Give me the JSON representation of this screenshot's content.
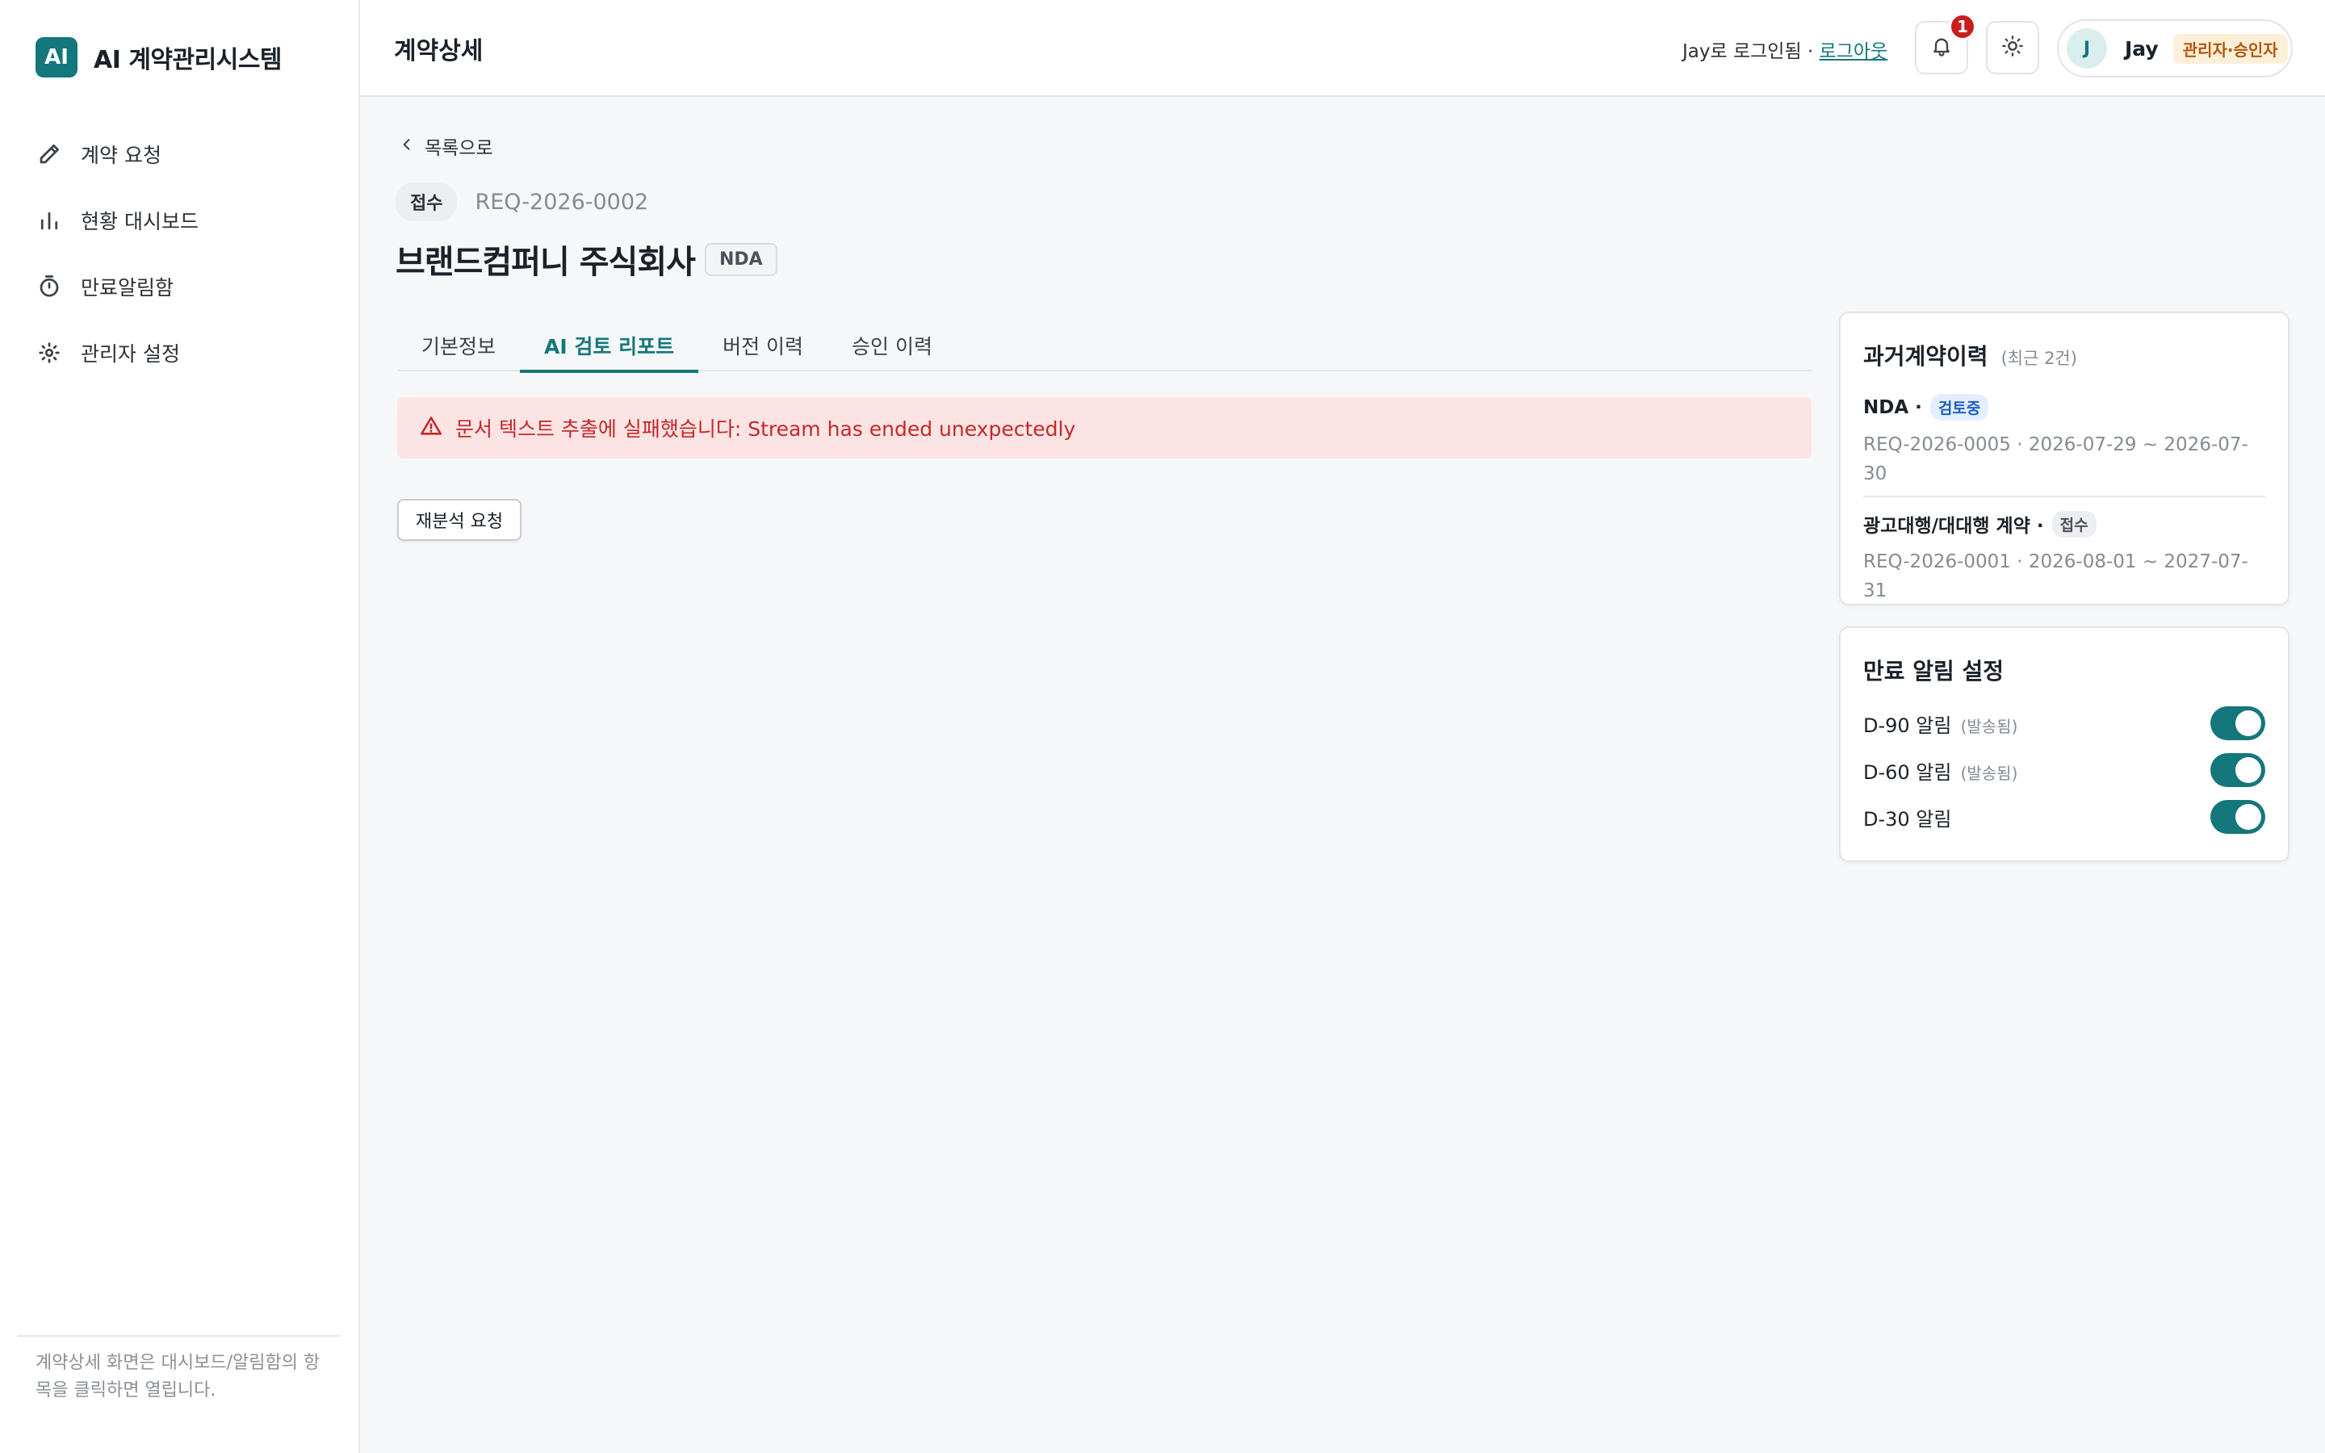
{
  "sidebar": {
    "logo_text": "AI",
    "title": "AI 계약관리시스템",
    "items": [
      {
        "label": "계약 요청",
        "icon": "pencil-icon"
      },
      {
        "label": "현황 대시보드",
        "icon": "bar-chart-icon"
      },
      {
        "label": "만료알림함",
        "icon": "timer-icon"
      },
      {
        "label": "관리자 설정",
        "icon": "gear-icon"
      }
    ],
    "footer_note": "계약상세 화면은 대시보드/알림함의 항목을 클릭하면 열립니다."
  },
  "header": {
    "title": "계약상세",
    "login_text": "Jay로 로그인됨 · ",
    "logout_label": "로그아웃",
    "notification_count": "1",
    "user_initial": "J",
    "user_name": "Jay",
    "user_role": "관리자·승인자"
  },
  "main": {
    "back_label": "목록으로",
    "status": "접수",
    "request_id": "REQ-2026-0002",
    "contract_title": "브랜드컴퍼니 주식회사",
    "contract_type": "NDA",
    "tabs": [
      {
        "label": "기본정보",
        "active": false
      },
      {
        "label": "AI 검토 리포트",
        "active": true
      },
      {
        "label": "버전 이력",
        "active": false
      },
      {
        "label": "승인 이력",
        "active": false
      }
    ],
    "error_message": "문서 텍스트 추출에 실패했습니다: Stream has ended unexpectedly",
    "reanalyze_label": "재분석 요청"
  },
  "history_card": {
    "title": "과거계약이력",
    "subtitle": "(최근 2건)",
    "items": [
      {
        "type": "NDA ·",
        "status": "검토중",
        "detail": "REQ-2026-0005 · 2026-07-29 ~ 2026-07-30"
      },
      {
        "type": "광고대행/대대행 계약 ·",
        "status": "접수",
        "detail": "REQ-2026-0001 · 2026-08-01 ~ 2027-07-31"
      }
    ]
  },
  "alerts_card": {
    "title": "만료 알림 설정",
    "items": [
      {
        "label": "D-90 알림",
        "note": "(발송됨)",
        "enabled": true
      },
      {
        "label": "D-60 알림",
        "note": "(발송됨)",
        "enabled": true
      },
      {
        "label": "D-30 알림",
        "note": "",
        "enabled": true
      }
    ]
  },
  "colors": {
    "accent": "#14777b",
    "error_bg": "#fde4e4",
    "error_text": "#c62828",
    "role_badge_bg": "#fdf0d9",
    "role_badge_text": "#b4560a"
  }
}
